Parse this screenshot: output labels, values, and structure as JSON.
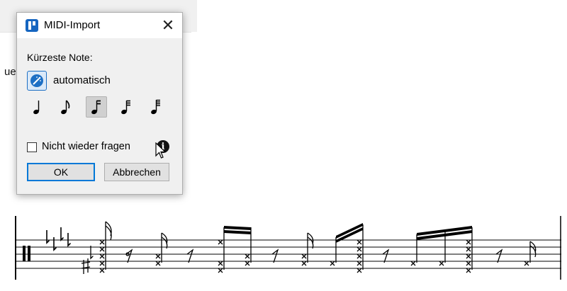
{
  "background_app": {
    "text_fragment": "ue"
  },
  "dialog": {
    "title": "MIDI-Import",
    "close_glyph": "✕",
    "section_label": "Kürzeste Note:",
    "auto_label": "automatisch",
    "note_options": [
      {
        "name": "quarter-note",
        "selected": false
      },
      {
        "name": "eighth-note",
        "selected": false
      },
      {
        "name": "sixteenth-note",
        "selected": true
      },
      {
        "name": "thirty-second-note",
        "selected": false
      },
      {
        "name": "sixty-fourth-note",
        "selected": false
      }
    ],
    "checkbox_label": "Nicht wieder fragen",
    "checkbox_checked": false,
    "info_glyph": "i",
    "ok_label": "OK",
    "cancel_label": "Abbrechen"
  },
  "score": {
    "clef": "percussion",
    "key_signature_flats": 4
  },
  "colors": {
    "accent": "#0078d7",
    "dialog_bg": "#f0f0f0",
    "app_icon": "#1565c0"
  }
}
